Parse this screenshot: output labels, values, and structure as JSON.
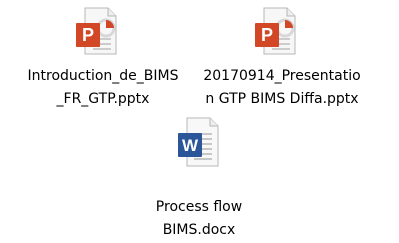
{
  "desktop": {
    "files": [
      {
        "type": "PowerPoint",
        "icon": "powerpoint-document-icon",
        "badge": "P",
        "accent": "#d24726",
        "name_lines": [
          "Introduction_de_BIMS",
          "_FR_GTP.pptx"
        ]
      },
      {
        "type": "PowerPoint",
        "icon": "powerpoint-document-icon",
        "badge": "P",
        "accent": "#d24726",
        "name_lines": [
          "20170914_Presentatio",
          "n GTP BIMS Diffa.pptx"
        ]
      },
      {
        "type": "Word",
        "icon": "word-document-icon",
        "badge": "W",
        "accent": "#2b579a",
        "name_lines": [
          "Process flow",
          "BIMS.docx"
        ]
      }
    ]
  }
}
